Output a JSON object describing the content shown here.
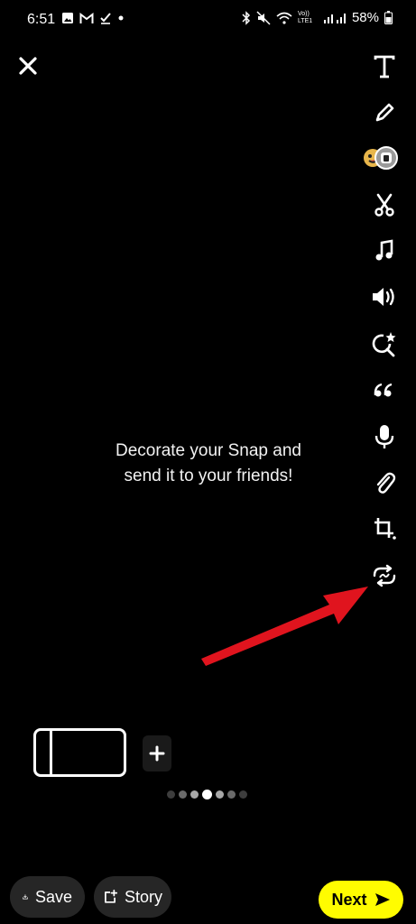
{
  "status_bar": {
    "time": "6:51",
    "battery": "58%",
    "left_icons": [
      "image-icon",
      "gmail-icon",
      "check-icon",
      "dot-icon"
    ],
    "right_icons": [
      "bluetooth-icon",
      "mute-icon",
      "wifi-icon",
      "volte-icon",
      "signal-icon",
      "battery-icon"
    ],
    "volte_label": "Vo)) LTE1"
  },
  "toolbar": {
    "items": [
      {
        "name": "text",
        "icon": "text-T-icon"
      },
      {
        "name": "draw",
        "icon": "pencil-icon"
      },
      {
        "name": "stickers",
        "icon": "sticker-icon"
      },
      {
        "name": "scissors",
        "icon": "scissors-icon"
      },
      {
        "name": "music",
        "icon": "music-note-icon"
      },
      {
        "name": "sound",
        "icon": "speaker-icon"
      },
      {
        "name": "lens",
        "icon": "lens-search-icon"
      },
      {
        "name": "quote",
        "icon": "quote-icon"
      },
      {
        "name": "voice",
        "icon": "microphone-icon"
      },
      {
        "name": "attach",
        "icon": "paperclip-icon"
      },
      {
        "name": "crop",
        "icon": "crop-icon"
      },
      {
        "name": "loop",
        "icon": "loop-icon"
      }
    ]
  },
  "center_message": {
    "line1": "Decorate your Snap and",
    "line2": "send it to your friends!"
  },
  "bottom": {
    "save_label": "Save",
    "story_label": "Story",
    "next_label": "Next",
    "page_indicator": {
      "count": 7,
      "active_index": 3
    }
  },
  "colors": {
    "background": "#000000",
    "next_button": "#fffc00",
    "pill_button": "#262626",
    "annotation_arrow": "#e0141e"
  }
}
